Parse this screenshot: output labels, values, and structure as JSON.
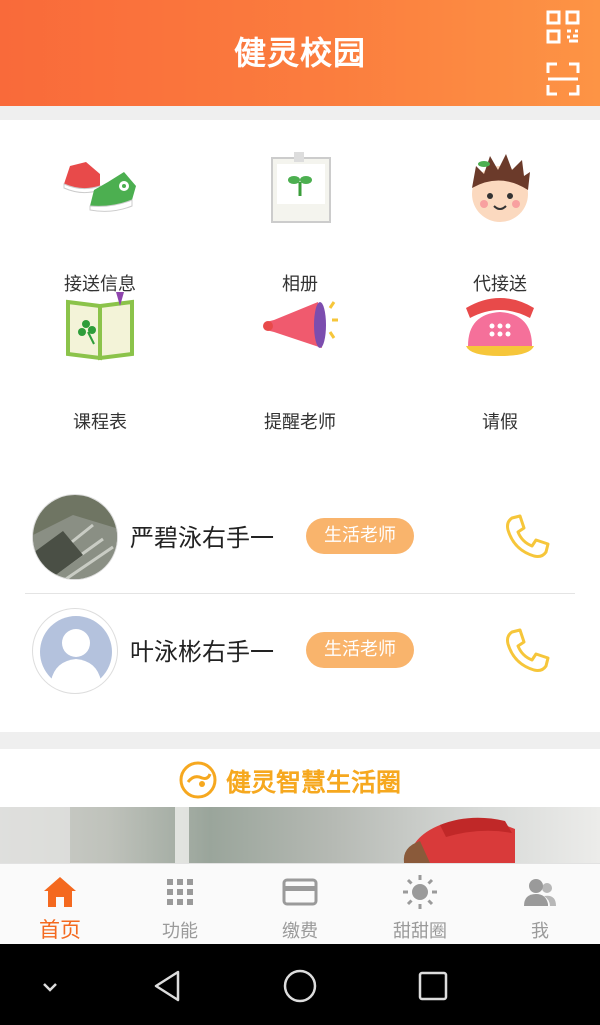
{
  "header": {
    "title": "健灵校园",
    "qr_icon": "qr-code-icon",
    "scan_icon": "scan-icon"
  },
  "features": [
    {
      "label": "接送信息",
      "icon": "sneakers-icon"
    },
    {
      "label": "相册",
      "icon": "photo-album-icon"
    },
    {
      "label": "代接送",
      "icon": "child-face-icon"
    },
    {
      "label": "课程表",
      "icon": "open-book-icon"
    },
    {
      "label": "提醒老师",
      "icon": "megaphone-icon"
    },
    {
      "label": "请假",
      "icon": "telephone-icon"
    }
  ],
  "teachers": [
    {
      "name": "严碧泳右手一",
      "role": "生活老师",
      "avatar": "photo-avatar"
    },
    {
      "name": "叶泳彬右手一",
      "role": "生活老师",
      "avatar": "default-avatar"
    }
  ],
  "banner": {
    "title": "健灵智慧生活圈"
  },
  "tabbar": [
    {
      "label": "首页",
      "icon": "home-icon",
      "active": true
    },
    {
      "label": "功能",
      "icon": "grid-icon",
      "active": false
    },
    {
      "label": "缴费",
      "icon": "card-icon",
      "active": false
    },
    {
      "label": "甜甜圈",
      "icon": "sun-icon",
      "active": false
    },
    {
      "label": "我",
      "icon": "user-icon",
      "active": false
    }
  ],
  "colors": {
    "accent": "#f4691f",
    "badge": "#f9b46c",
    "phone": "#f6c63a",
    "banner_text": "#f6a81f"
  }
}
